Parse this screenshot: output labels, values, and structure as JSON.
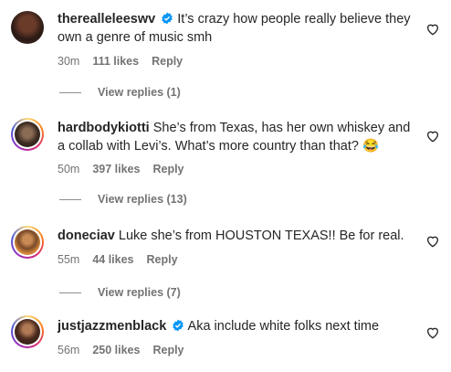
{
  "comments": [
    {
      "username": "therealleleeswv",
      "verified": true,
      "text": "It’s crazy how people really believe they own a genre of music smh",
      "time": "30m",
      "likes": "111 likes",
      "reply": "Reply",
      "view_replies": "View replies (1)"
    },
    {
      "username": "hardbodykiotti",
      "verified": false,
      "text": "She’s from Texas, has her own whiskey and a collab with Levi’s. What’s more country than that? 😂",
      "time": "50m",
      "likes": "397 likes",
      "reply": "Reply",
      "view_replies": "View replies (13)"
    },
    {
      "username": "doneciav",
      "verified": false,
      "text": "Luke she’s from HOUSTON TEXAS!! Be for real.",
      "time": "55m",
      "likes": "44 likes",
      "reply": "Reply",
      "view_replies": "View replies (7)"
    },
    {
      "username": "justjazzmenblack",
      "verified": true,
      "text": "Aka include white folks next time",
      "time": "56m",
      "likes": "250 likes",
      "reply": "Reply"
    }
  ],
  "icons": {
    "verified": "verified-badge-icon",
    "like": "heart-outline-icon"
  },
  "colors": {
    "text": "#262626",
    "muted": "#737373",
    "verified": "#0095f6"
  }
}
